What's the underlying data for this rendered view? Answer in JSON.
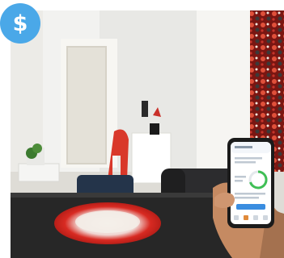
{
  "badge": {
    "symbol": "$",
    "color": "#4aa8e8"
  },
  "photo": {
    "subject": "living-room-with-smartphone-energy-app",
    "colors": {
      "wall": "#f2f2f0",
      "table": "#2a2a2a",
      "doily": "#d82a22",
      "phone_accent": "#3a8de0",
      "gauge": "#3fbf55"
    }
  }
}
